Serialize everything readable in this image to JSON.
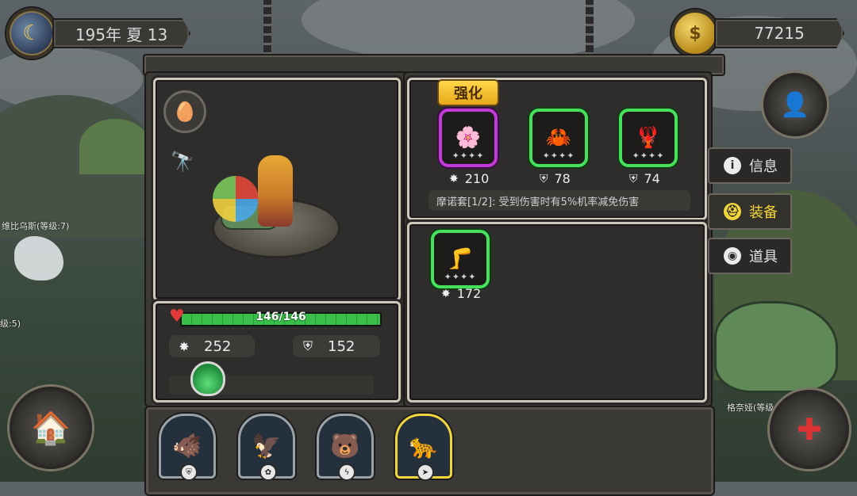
{
  "top_left": {
    "date": "195年 夏 13",
    "icon": "moon-sun-icon"
  },
  "top_right": {
    "gold": "77215",
    "icon": "coin-icon"
  },
  "hero_panel": {
    "hp": "146/146",
    "hp_fraction": 1.0,
    "attack": "252",
    "defense": "152",
    "icons": [
      "egg-icon",
      "telescope-map-icon",
      "potion-icon"
    ]
  },
  "equipment": {
    "enhance_label": "强化",
    "slots": [
      {
        "stat_icon": "attack-icon",
        "value": "210",
        "rarity": "purple"
      },
      {
        "stat_icon": "shield-icon",
        "value": "78",
        "rarity": "green"
      },
      {
        "stat_icon": "shield-icon",
        "value": "74",
        "rarity": "green"
      }
    ],
    "set_description": "摩诺套[1/2]: 受到伤害时有5%机率减免伤害",
    "inventory": [
      {
        "stat_icon": "attack-icon",
        "value": "172",
        "rarity": "green"
      }
    ]
  },
  "side_tabs": [
    {
      "label": "信息",
      "icon": "info-icon",
      "active": false
    },
    {
      "label": "装备",
      "icon": "helmet-icon",
      "active": true
    },
    {
      "label": "道具",
      "icon": "bag-icon",
      "active": false
    }
  ],
  "npc_labels": {
    "left_top": "维比乌斯(等级:7)",
    "left_mid": "级:5)",
    "right": "格奈娅(等级"
  },
  "portraits": [
    {
      "name": "boar-portrait",
      "selected": false
    },
    {
      "name": "eagle-portrait",
      "selected": false
    },
    {
      "name": "polar-bear-portrait",
      "selected": false
    },
    {
      "name": "leopard-portrait",
      "selected": true
    }
  ],
  "colors": {
    "hp": "#3ac04a",
    "active_tab": "#f2d53c",
    "rare_purple": "#c23ad8",
    "rare_green": "#46e05a"
  }
}
